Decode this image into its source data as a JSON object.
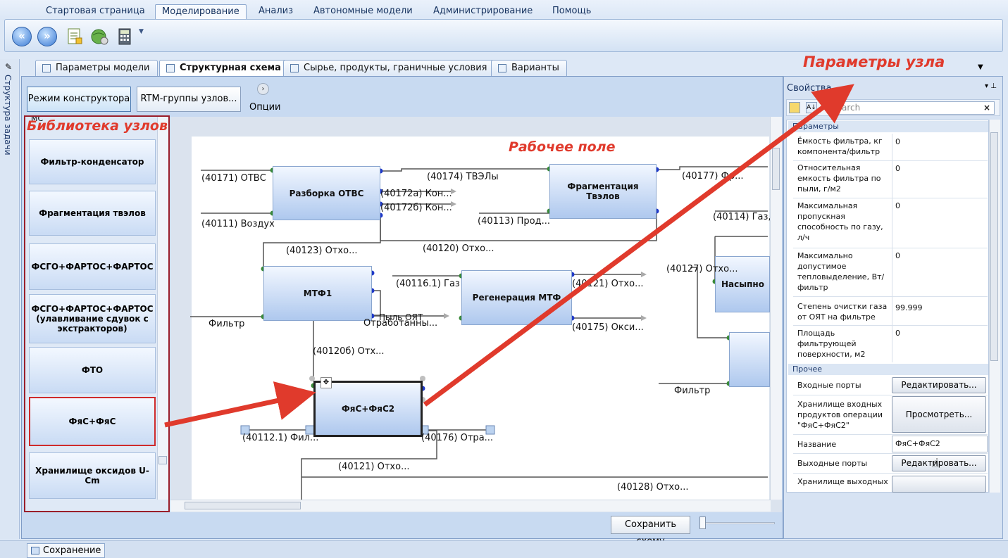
{
  "ribbon": {
    "tabs": [
      "Стартовая страница",
      "Моделирование",
      "Анализ",
      "Автономные модели",
      "Администрирование",
      "Помощь"
    ],
    "active_tab": "Моделирование"
  },
  "side_panel_label": "Структура задачи",
  "doc_tabs": [
    "Параметры модели",
    "Структурная схема",
    "Сырье, продукты, граничные условия",
    "Варианты"
  ],
  "toolbar": {
    "constructor_mode": "Режим конструктора",
    "rtm_groups": "RTM-группы узлов...",
    "options": "Опции"
  },
  "annotations": {
    "library": "Библиотека узлов",
    "workspace": "Рабочее поле",
    "node_params": "Параметры узла"
  },
  "library": {
    "partial_top": "МС",
    "items": [
      "Фильтр-конденсатор",
      "Фрагментация твэлов",
      "ФСГО+ФАРТОС+ФАРТОС",
      "ФСГО+ФАРТОС+ФАРТОС (улавливание сдувок с экстракторов)",
      "ФТО",
      "ФяС+ФяС",
      "Хранилище оксидов U-Cm"
    ],
    "selected": "ФяС+ФяС"
  },
  "diagram": {
    "nodes": [
      "Разборка ОТВС",
      "Фрагментация Твэлов",
      "МТФ1",
      "Регенерация МТФ",
      "ФяС+ФяС2",
      "Насыпно"
    ],
    "labels": [
      "(40171) ОТВС",
      "(40111) Воздух",
      "(40174)  ТВЭЛы",
      "(40172а)  Кон...",
      "(40172б)  Кон...",
      "(40113) Прод...",
      "(40177)  Фр...",
      "(40114) Газ,",
      "(40123)  Отхо...",
      "(40120)  Отхо...",
      "(40127)  Отхо...",
      "(40116.1) Газ",
      "(40121)  Отхо...",
      "Фильтр",
      "Отработанны...",
      "Пыль ОЯТ",
      "(40175) Окси...",
      "(40120б)  Отх...",
      "Фильтр",
      "(40112.1) Фил...",
      "(40176)  Отра...",
      "(40121)  Отхо...",
      "(40128)  Отхо..."
    ]
  },
  "save_button": "Сохранить схему",
  "properties": {
    "title": "Свойства",
    "search_placeholder": "Search",
    "category_params": "Параметры",
    "category_other": "Прочее",
    "rows": [
      {
        "name": "Ёмкость фильтра, кг компонента/фильтр",
        "value": "0"
      },
      {
        "name": "Относительная емкость фильтра по пыли, г/м2",
        "value": "0"
      },
      {
        "name": "Максимальная пропускная способность по газу, л/ч",
        "value": "0"
      },
      {
        "name": "Максимально допустимое тепловыделение, Вт/фильтр",
        "value": "0"
      },
      {
        "name": "Степень очистки газа от ОЯТ на фильтре",
        "value": "99.999"
      },
      {
        "name": "Площадь фильтрующей поверхности, м2",
        "value": "0"
      }
    ],
    "other_rows": [
      {
        "name": "Входные порты",
        "button": "Редактировать..."
      },
      {
        "name": "Хранилище входных продуктов операции \"ФяС+ФяС2\"",
        "button": "Просмотреть..."
      },
      {
        "name": "Название",
        "value": "ФяС+ФяС2"
      },
      {
        "name": "Выходные порты",
        "button": "Редактировать..."
      },
      {
        "name": "Хранилище выходных"
      }
    ]
  },
  "status_tab": "Сохранение",
  "colors": {
    "annotation_red": "#e03a2c",
    "port_green": "#3a8a3a",
    "port_blue": "#1f39c8"
  }
}
